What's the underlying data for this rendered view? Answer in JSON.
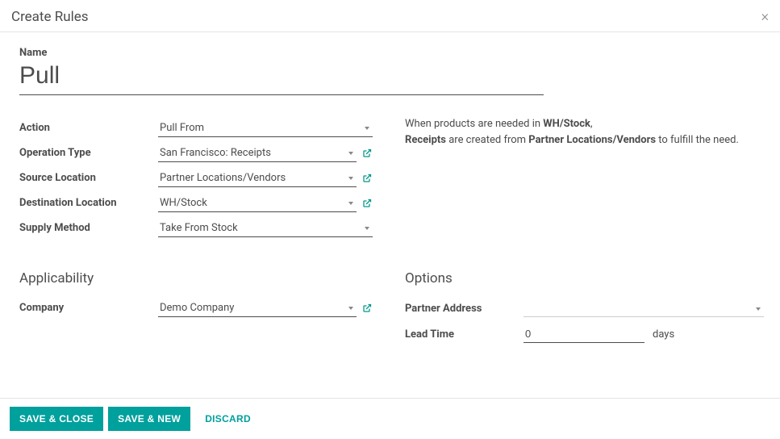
{
  "modal": {
    "title": "Create Rules"
  },
  "name": {
    "label": "Name",
    "value": "Pull"
  },
  "fields": {
    "action": {
      "label": "Action",
      "value": "Pull From"
    },
    "operation_type": {
      "label": "Operation Type",
      "value": "San Francisco: Receipts"
    },
    "source_location": {
      "label": "Source Location",
      "value": "Partner Locations/Vendors"
    },
    "destination_location": {
      "label": "Destination Location",
      "value": "WH/Stock"
    },
    "supply_method": {
      "label": "Supply Method",
      "value": "Take From Stock"
    }
  },
  "info": {
    "line1_a": "When products are needed in ",
    "line1_b": "WH/Stock",
    "line1_c": ",",
    "line2_a": "Receipts",
    "line2_b": " are created from ",
    "line2_c": "Partner Locations/Vendors",
    "line2_d": " to fulfill the need."
  },
  "applicability": {
    "heading": "Applicability",
    "company": {
      "label": "Company",
      "value": "Demo Company"
    }
  },
  "options": {
    "heading": "Options",
    "partner_address": {
      "label": "Partner Address",
      "value": ""
    },
    "lead_time": {
      "label": "Lead Time",
      "value": "0",
      "unit": "days"
    }
  },
  "footer": {
    "save_close": "SAVE & CLOSE",
    "save_new": "SAVE & NEW",
    "discard": "DISCARD"
  }
}
